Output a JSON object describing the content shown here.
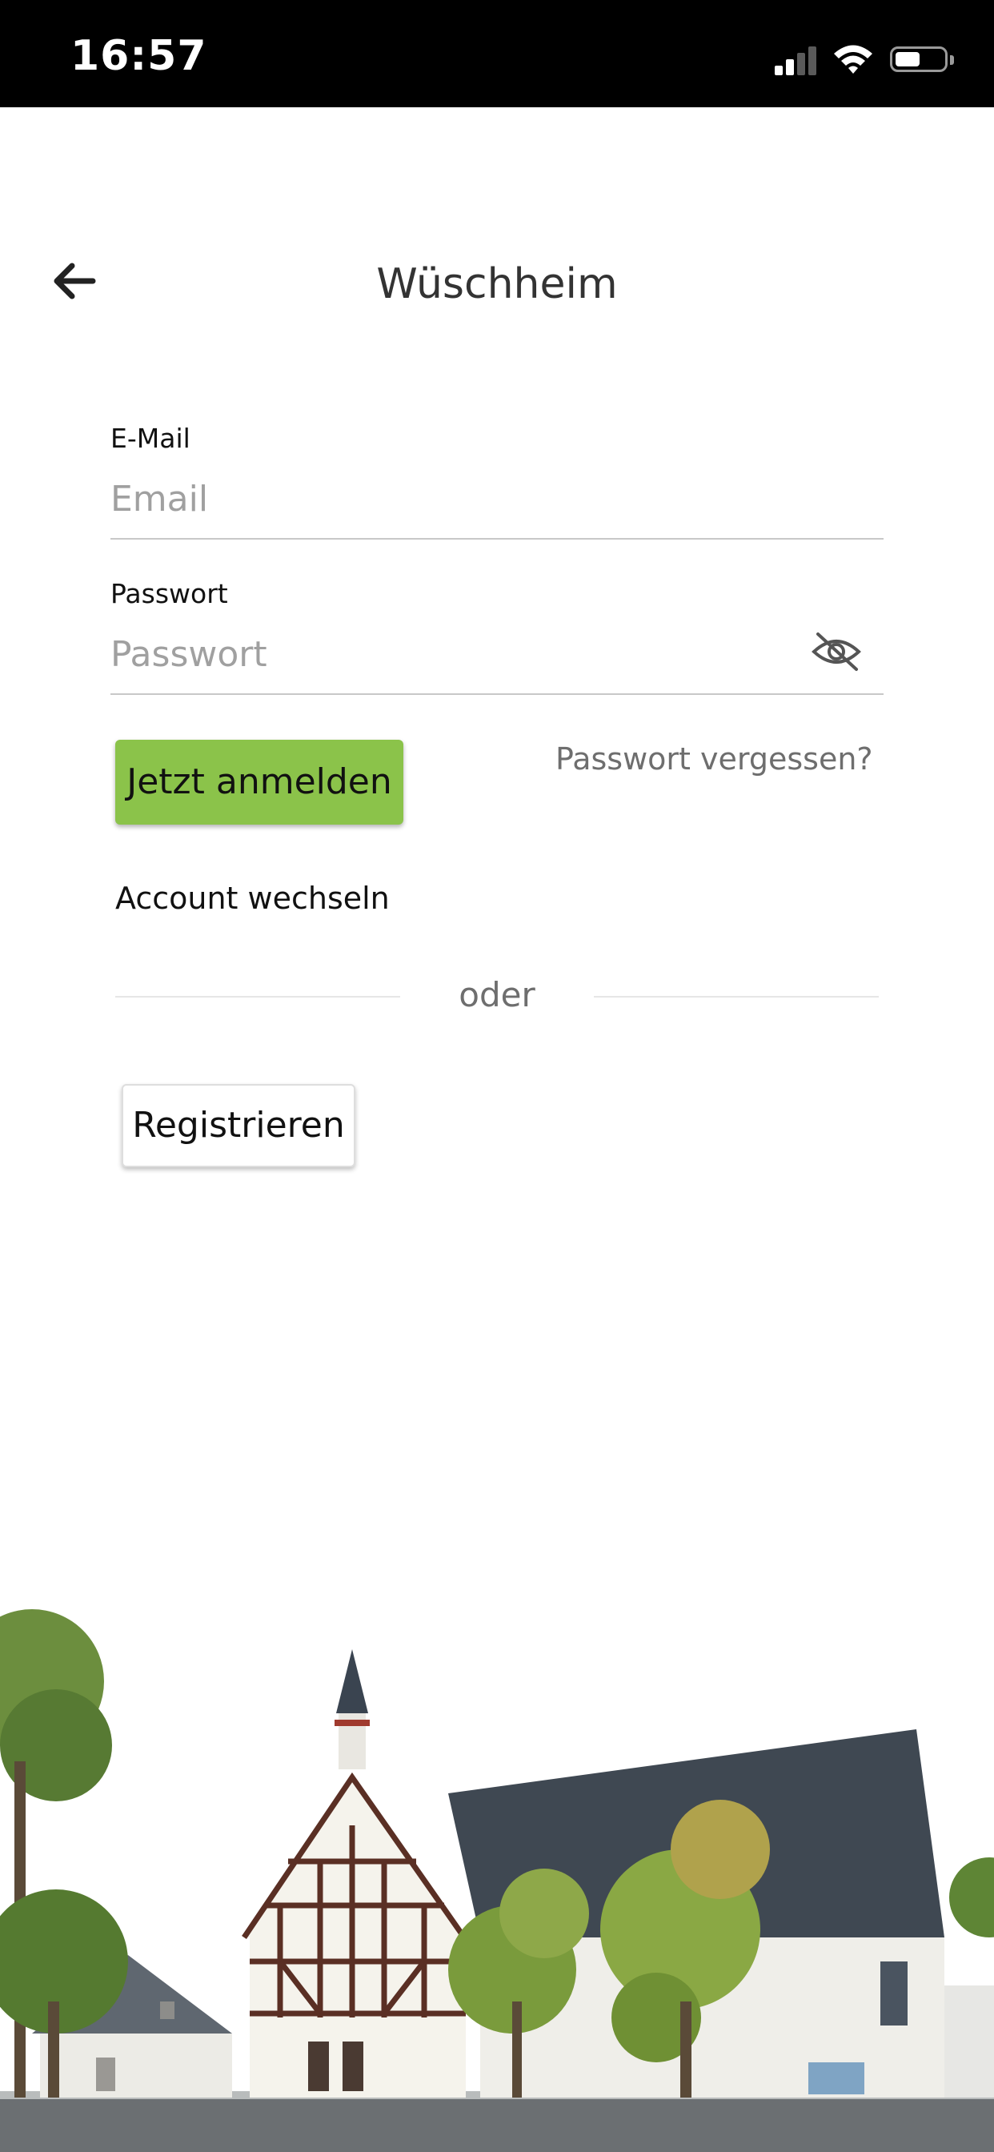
{
  "status_bar": {
    "time": "16:57",
    "icons": [
      "cellular-signal-icon",
      "wifi-icon",
      "battery-icon"
    ]
  },
  "header": {
    "back_icon": "arrow-left-icon",
    "title": "Wüschheim"
  },
  "form": {
    "email": {
      "label": "E-Mail",
      "placeholder": "Email",
      "value": ""
    },
    "password": {
      "label": "Passwort",
      "placeholder": "Passwort",
      "value": "",
      "toggle_icon": "eye-off-icon"
    },
    "login_label": "Jetzt anmelden",
    "forgot_label": "Passwort vergessen?",
    "switch_account_label": "Account wechseln",
    "divider_label": "oder",
    "register_label": "Registrieren"
  },
  "colors": {
    "primary_green": "#8bc34a",
    "status_bar_bg": "#000000",
    "muted_text": "#6e6e6e"
  },
  "footer_image": "town-hall-illustration"
}
